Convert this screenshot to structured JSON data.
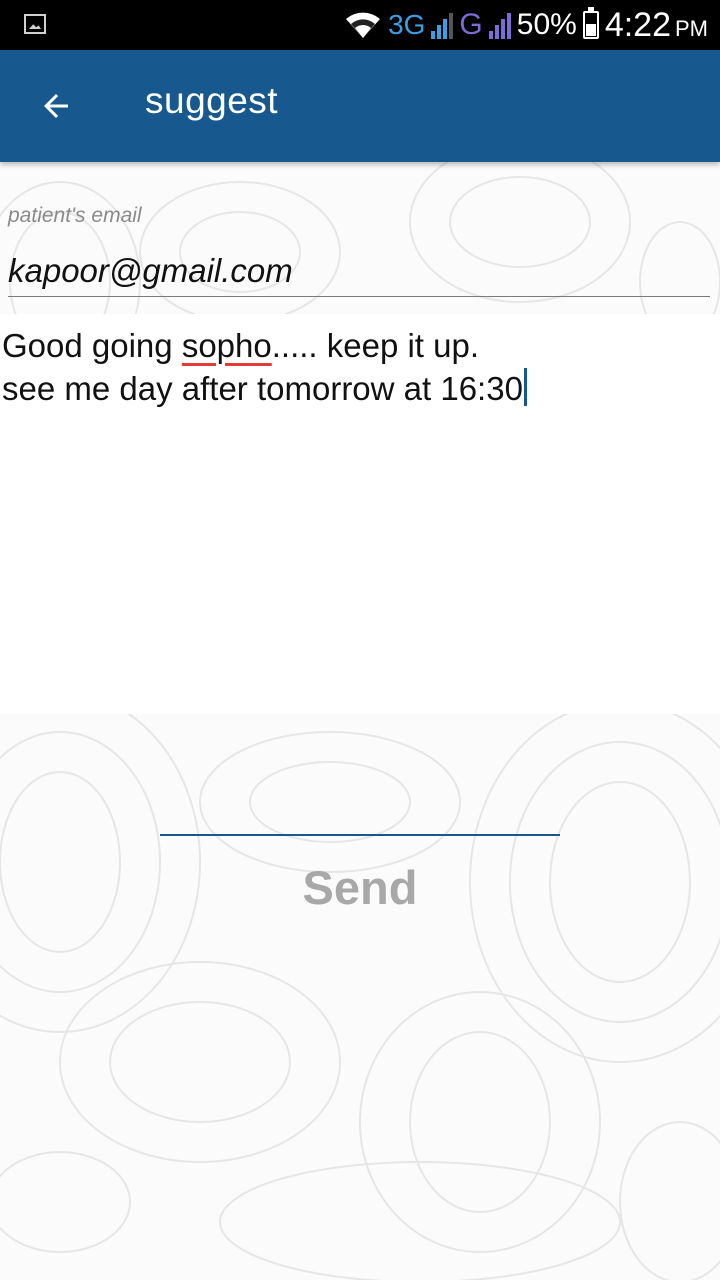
{
  "status_bar": {
    "gallery_icon": "image-icon",
    "wifi_icon": "wifi-icon",
    "network_3g": "3G",
    "network_g": "G",
    "battery_percent": "50%",
    "battery_level": 0.5,
    "time": "4:22",
    "ampm": "PM"
  },
  "app_bar": {
    "title": "suggest",
    "back_icon": "arrow-back-icon",
    "color": "#17598e"
  },
  "form": {
    "email_label": "patient's email",
    "email_value": "kapoor@gmail.com",
    "message_line1_a": "Good going ",
    "message_line1_misspelled": "sopho",
    "message_line1_b": "..... keep it up.",
    "message_line2": "see me day after tomorrow at 16:30",
    "send_label": "Send"
  }
}
